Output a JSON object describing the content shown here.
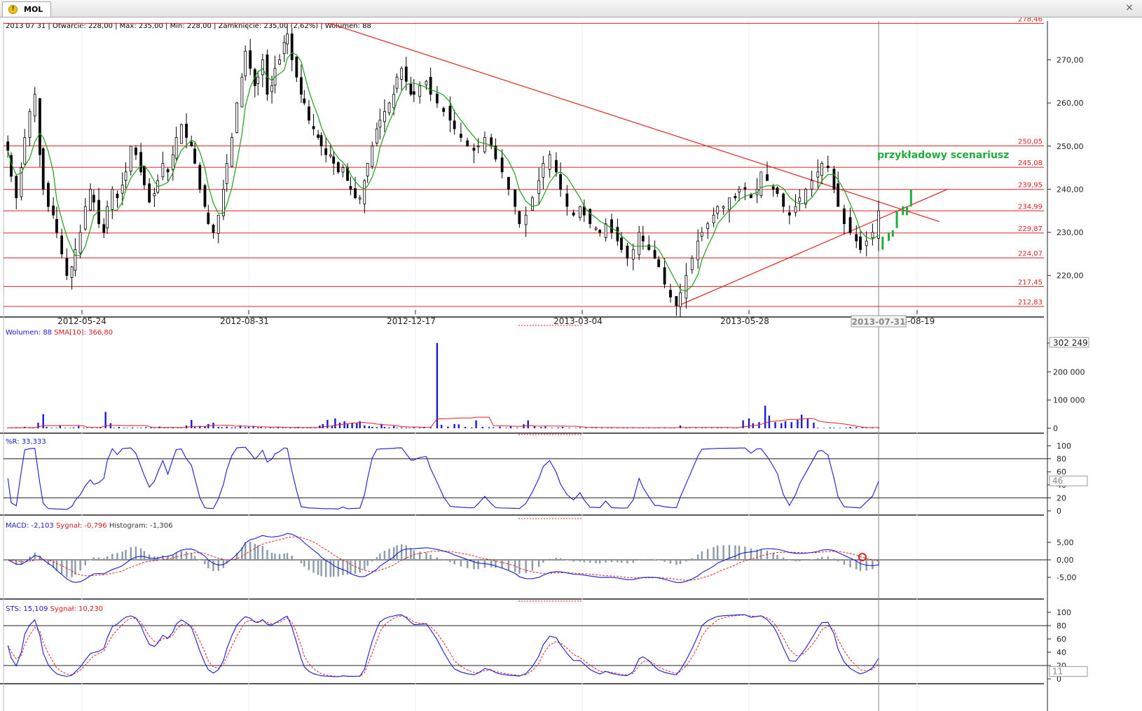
{
  "window": {
    "tab_label": "MOL",
    "tab_icon": "warning-icon",
    "close_icon": "close-icon"
  },
  "headers": {
    "price": "2013 07 31 | Otwarcie: 228,00 | Max: 235,00 | Min: 228,00 | Zamknięcie: 235,00 (2,62%)  | Wolumen: 88",
    "volume_label": "Wolumen: 88",
    "volume_sma": "SMA[10]: 366,80",
    "wr": "%R: 33,333",
    "macd": "MACD: -2,103",
    "macd_signal": "Sygnał: -0,796",
    "macd_hist": "Histogram: -1,306",
    "sts": "STS: 15,109",
    "sts_signal": "Sygnał: 10,230"
  },
  "colors": {
    "candle": "#000000",
    "ma": "#1aa01a",
    "levels": "#e02020",
    "volume": "#1a1ad8",
    "osc": "#1a1ad8",
    "signal": "#e02020",
    "hist": "#8a9aaa",
    "scenario": "#1fae3c"
  },
  "chart_data": [
    {
      "type": "candlestick",
      "panel": "price",
      "ylim": [
        212,
        279
      ],
      "y_ticks": [
        "270,00",
        "260,00",
        "250,00",
        "240,00",
        "230,00",
        "220,00"
      ],
      "x_ticks": [
        "2012-05-24",
        "2012-08-31",
        "2012-12-17",
        "2013-03-04",
        "2013-05-28",
        "13-08-19"
      ],
      "current_date_label": "2013-07-31",
      "annotation": "przykładowy scenariusz",
      "levels": [
        {
          "value": 278.46,
          "label": "278,46"
        },
        {
          "value": 250.05,
          "label": "250,05"
        },
        {
          "value": 245.08,
          "label": "245,08"
        },
        {
          "value": 239.95,
          "label": "239,95"
        },
        {
          "value": 234.99,
          "label": "234,99"
        },
        {
          "value": 229.87,
          "label": "229,87"
        },
        {
          "value": 224.07,
          "label": "224,07"
        },
        {
          "value": 217.45,
          "label": "217,45"
        },
        {
          "value": 212.83,
          "label": "212,83"
        }
      ],
      "trendlines": [
        {
          "from": [
            "2012-10-22",
            278.5
          ],
          "to": [
            "2013-08-30",
            232.5
          ]
        },
        {
          "from": [
            "2013-04-22",
            213
          ],
          "to": [
            "2013-09-03",
            240
          ]
        }
      ],
      "close": [
        249,
        243,
        238,
        245,
        252,
        258,
        262,
        248,
        240,
        236,
        234,
        230,
        225,
        220,
        222,
        226,
        230,
        236,
        240,
        237,
        232,
        230,
        236,
        240,
        238,
        241,
        244,
        250,
        248,
        244,
        241,
        237,
        239,
        242,
        246,
        244,
        248,
        252,
        255,
        252,
        250,
        246,
        240,
        236,
        232,
        230,
        234,
        240,
        246,
        252,
        260,
        266,
        272,
        268,
        264,
        266,
        270,
        262,
        264,
        268,
        270,
        274,
        276,
        270,
        266,
        262,
        260,
        256,
        254,
        252,
        250,
        248,
        248,
        246,
        244,
        245,
        242,
        240,
        238,
        238,
        242,
        246,
        250,
        254,
        256,
        258,
        260,
        262,
        266,
        268,
        265,
        262,
        262,
        264,
        265,
        262,
        260,
        258,
        256,
        254,
        252,
        250,
        249,
        250,
        252,
        250,
        247,
        244,
        240,
        236,
        232,
        234,
        238,
        242,
        246,
        248,
        244,
        240,
        236,
        234,
        236,
        234,
        232,
        231,
        230,
        232,
        230,
        228,
        226,
        224,
        226,
        230,
        228,
        226,
        224,
        222,
        218,
        215,
        213,
        216,
        220,
        224,
        228,
        230,
        232,
        234,
        236,
        236,
        238,
        238,
        240,
        240,
        238,
        240,
        244,
        242,
        240,
        239,
        236,
        234,
        236,
        238,
        240,
        242,
        244,
        246,
        245,
        240,
        236,
        232,
        230,
        228,
        226,
        228,
        230,
        235
      ],
      "projection": [
        {
          "date": "2013-08-02",
          "open": 226,
          "close": 229
        },
        {
          "date": "2013-08-05",
          "open": 228,
          "close": 230
        },
        {
          "date": "2013-08-07",
          "open": 229,
          "close": 230.5
        },
        {
          "date": "2013-08-09",
          "open": 231,
          "close": 235
        },
        {
          "date": "2013-08-12",
          "open": 234,
          "close": 236
        },
        {
          "date": "2013-08-14",
          "open": 234,
          "close": 236
        },
        {
          "date": "2013-08-16",
          "open": 236,
          "close": 240
        }
      ]
    },
    {
      "type": "bar",
      "panel": "volume",
      "ylim": [
        0,
        310000
      ],
      "y_ticks": [
        "302 249",
        "200 000",
        "100 000",
        "0"
      ],
      "values": [
        2000,
        1500,
        3000,
        1500,
        5000,
        2500,
        2000,
        20000,
        50000,
        5000,
        2000,
        1500,
        10000,
        2000,
        1500,
        3000,
        8000,
        2000,
        1500,
        2000,
        1000,
        3000,
        58000,
        18000,
        2000,
        5000,
        2000,
        1500,
        3000,
        1500,
        2000,
        4000,
        3000,
        2000,
        6000,
        3000,
        2000,
        3000,
        2000,
        1500,
        10000,
        30000,
        5000,
        8000,
        6000,
        15000,
        20000,
        5000,
        4000,
        6000,
        3000,
        3000,
        10000,
        4000,
        5000,
        8000,
        3000,
        5000,
        2000,
        3000,
        1500,
        4000,
        2000,
        1500,
        3000,
        2000,
        5000,
        3000,
        2000,
        4000,
        2000,
        10000,
        15000,
        30000,
        8000,
        35000,
        20000,
        25000,
        15000,
        20000,
        18000,
        25000,
        10000,
        8000,
        5000,
        4000,
        15000,
        5000,
        3000,
        8000,
        2000,
        3000,
        2000,
        1500,
        3000,
        2000,
        5000,
        3000,
        302249,
        12000,
        6000,
        15000,
        14000,
        5000,
        3000,
        28000,
        5000,
        4000,
        3000,
        6000,
        2000,
        8000,
        2000,
        14000,
        28000,
        7000,
        4000,
        6000,
        2000,
        3000,
        5000,
        2000,
        1500,
        3000,
        2000,
        1500,
        3000,
        2000,
        1500,
        3000,
        2000,
        3000,
        1500,
        2000,
        1500,
        3000,
        2000,
        1500,
        3000,
        2000,
        1500,
        2000,
        10000,
        2000,
        1500,
        3000,
        2000,
        1500,
        3000,
        2000,
        1500,
        2000,
        1500,
        3000,
        28000,
        35000,
        18000,
        22000,
        80000,
        45000,
        22000,
        18000,
        25000,
        22000,
        30000,
        48000,
        35000,
        20000,
        2000,
        1500,
        3000,
        2000,
        1500,
        2000,
        5000,
        4000,
        3000,
        2000,
        1500,
        2000
      ]
    },
    {
      "type": "line",
      "panel": "williams_r",
      "ylim": [
        0,
        100
      ],
      "y_ticks": [
        "100",
        "80",
        "60",
        "40",
        "20",
        "0"
      ],
      "current_label": "46"
    },
    {
      "type": "line",
      "panel": "macd",
      "ylim": [
        -10,
        8
      ],
      "y_ticks": [
        "5,00",
        "0,00",
        "-5,00"
      ]
    },
    {
      "type": "line",
      "panel": "stochastic",
      "ylim": [
        0,
        100
      ],
      "y_ticks": [
        "100",
        "80",
        "60",
        "40",
        "20",
        "0"
      ],
      "current_label": "11"
    }
  ]
}
